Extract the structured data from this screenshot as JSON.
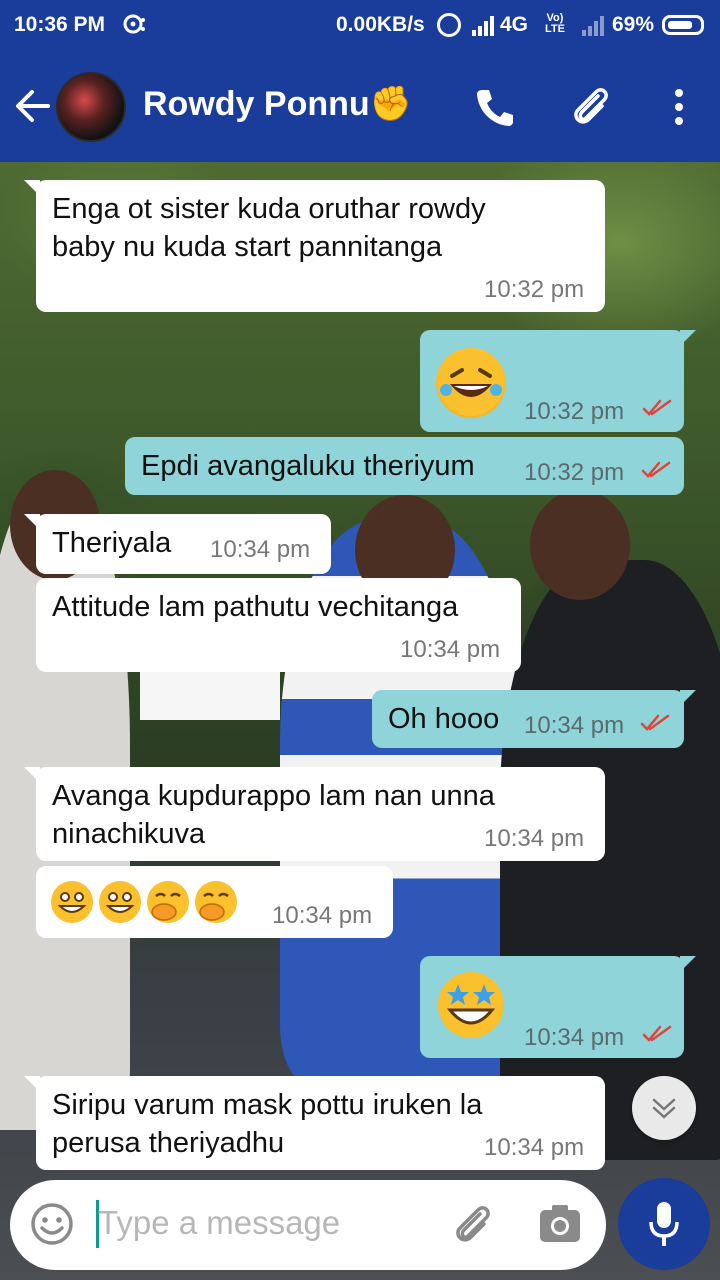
{
  "status_bar": {
    "time": "10:36 PM",
    "network_speed": "0.00KB/s",
    "network_type": "4G",
    "volte_top": "Vo)",
    "volte_bottom": "LTE",
    "battery": "69%"
  },
  "header": {
    "contact_name": "Rowdy Ponnu✊",
    "icons": [
      "back-arrow-icon",
      "phone-icon",
      "paperclip-icon",
      "more-vert-icon"
    ]
  },
  "messages": [
    {
      "dir": "in",
      "text_lines": [
        "Enga ot sister kuda oruthar rowdy",
        "baby nu kuda start pannitanga"
      ],
      "time": "10:32 pm"
    },
    {
      "dir": "out",
      "emoji": "rolling-on-floor-laughing",
      "time": "10:32 pm"
    },
    {
      "dir": "out",
      "text": "Epdi avangaluku theriyum",
      "time": "10:32 pm"
    },
    {
      "dir": "in",
      "text": "Theriyala",
      "time": "10:34 pm"
    },
    {
      "dir": "in",
      "text": "Attitude lam pathutu vechitanga",
      "time": "10:34 pm"
    },
    {
      "dir": "out",
      "text": "Oh hooo",
      "time": "10:34 pm"
    },
    {
      "dir": "in",
      "text_lines": [
        "Avanga kupdurappo lam nan unna",
        "ninachikuva"
      ],
      "time": "10:34 pm"
    },
    {
      "dir": "in",
      "emoji": "grinning x2, hand-over-mouth x2",
      "time": "10:34 pm"
    },
    {
      "dir": "out",
      "emoji": "star-struck",
      "time": "10:34 pm"
    },
    {
      "dir": "in",
      "text_lines": [
        "Siripu varum mask pottu iruken la",
        "perusa theriyadhu"
      ],
      "time": "10:34 pm"
    }
  ],
  "composer": {
    "placeholder": "Type a message"
  },
  "colors": {
    "bar": "#1a3c9a",
    "outgoing_bubble": "#8ed4d9",
    "incoming_bubble": "#ffffff",
    "read_ticks": "#e0443a"
  }
}
